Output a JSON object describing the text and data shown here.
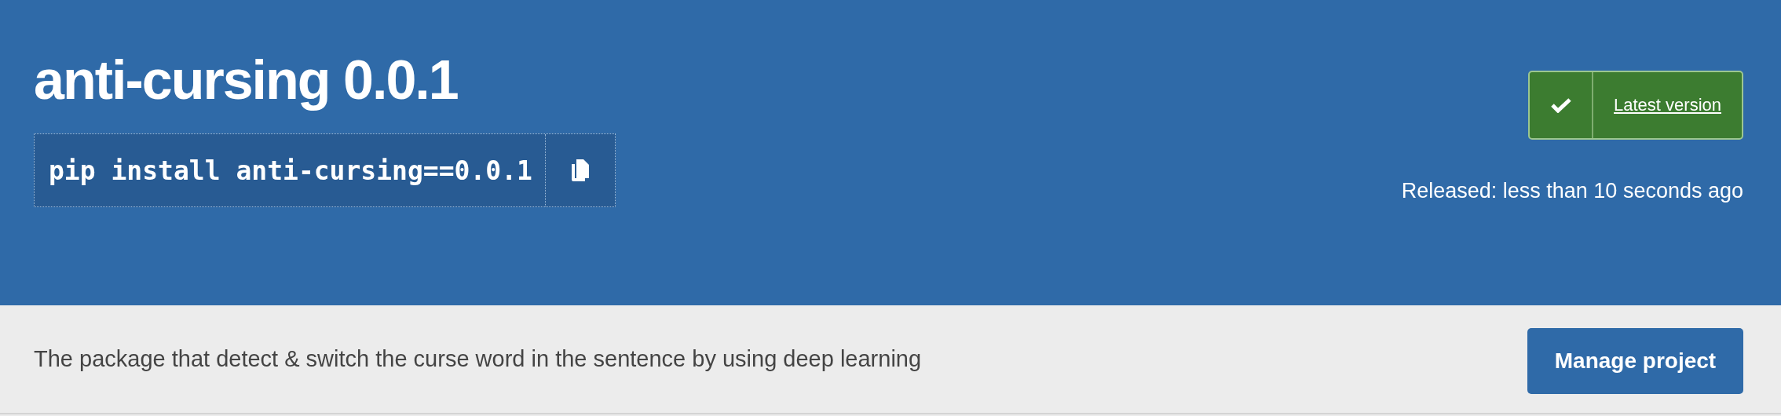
{
  "package": {
    "title": "anti-cursing 0.0.1",
    "install_command": "pip install anti-cursing==0.0.1",
    "latest_version": {
      "label": "Latest version",
      "is_latest": true
    },
    "released": "Released: less than 10 seconds ago"
  },
  "summary": {
    "description": "The package that detect & switch the curse word in the sentence by using deep learning",
    "button": "Manage project"
  }
}
